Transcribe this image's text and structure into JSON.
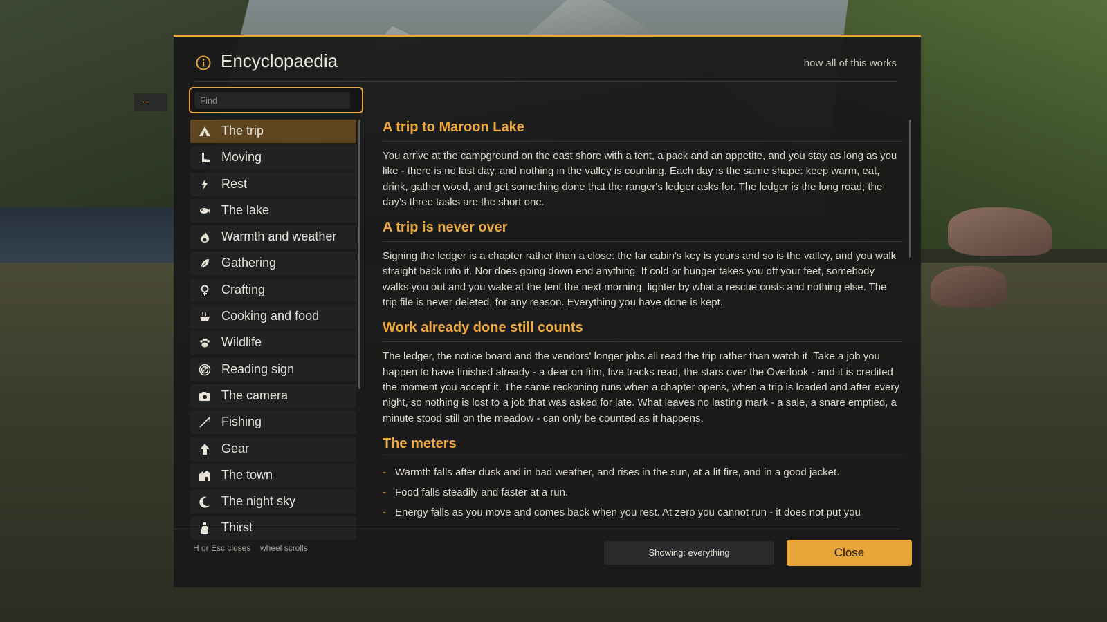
{
  "header": {
    "title": "Encyclopaedia",
    "help_link": "how all of this works"
  },
  "search": {
    "placeholder": "Find"
  },
  "side_tab": {
    "label": "–"
  },
  "topics": [
    {
      "label": "The trip",
      "icon": "tent-icon",
      "active": true
    },
    {
      "label": "Moving",
      "icon": "boot-icon"
    },
    {
      "label": "Rest",
      "icon": "lightning-icon"
    },
    {
      "label": "The lake",
      "icon": "fish-icon"
    },
    {
      "label": "Warmth and weather",
      "icon": "flame-icon"
    },
    {
      "label": "Gathering",
      "icon": "leaf-icon"
    },
    {
      "label": "Crafting",
      "icon": "knot-icon"
    },
    {
      "label": "Cooking and food",
      "icon": "pot-icon"
    },
    {
      "label": "Wildlife",
      "icon": "paw-icon"
    },
    {
      "label": "Reading sign",
      "icon": "spiral-icon"
    },
    {
      "label": "The camera",
      "icon": "camera-icon"
    },
    {
      "label": "Fishing",
      "icon": "fishing-rod-icon"
    },
    {
      "label": "Gear",
      "icon": "backpack-icon"
    },
    {
      "label": "The town",
      "icon": "house-icon"
    },
    {
      "label": "The night sky",
      "icon": "moon-icon"
    },
    {
      "label": "Thirst",
      "icon": "bottle-icon"
    }
  ],
  "article": {
    "sections": [
      {
        "heading": "A trip to Maroon Lake",
        "body": "You arrive at the campground on the east shore with a tent, a pack and an appetite, and you stay as long as you like - there is no last day, and nothing in the valley is counting. Each day is the same shape: keep warm, eat, drink, gather wood, and get something done that the ranger's ledger asks for. The ledger is the long road; the day's three tasks are the short one."
      },
      {
        "heading": "A trip is never over",
        "body": "Signing the ledger is a chapter rather than a close: the far cabin's key is yours and so is the valley, and you walk straight back into it. Nor does going down end anything. If cold or hunger takes you off your feet, somebody walks you out and you wake at the tent the next morning, lighter by what a rescue costs and nothing else. The trip file is never deleted, for any reason. Everything you have done is kept."
      },
      {
        "heading": "Work already done still counts",
        "body": "The ledger, the notice board and the vendors' longer jobs all read the trip rather than watch it. Take a job you happen to have finished already - a deer on film, five tracks read, the stars over the Overlook - and it is credited the moment you accept it. The same reckoning runs when a chapter opens, when a trip is loaded and after every night, so nothing is lost to a job that was asked for late. What leaves no lasting mark - a sale, a snare emptied, a minute stood still on the meadow - can only be counted as it happens."
      }
    ],
    "meters": {
      "heading": "The meters",
      "bullet_marker": "-",
      "bullets": [
        "Warmth falls after dusk and in bad weather, and rises in the sun, at a lit fire, and in a good jacket.",
        "Food falls steadily and faster at a run.",
        "Energy falls as you move and comes back when you rest. At zero you cannot run - it does not put you"
      ]
    }
  },
  "footer": {
    "hint_close": "H or Esc closes",
    "hint_scroll": "wheel scrolls",
    "filter_label": "Showing: everything",
    "close_label": "Close"
  },
  "colors": {
    "accent": "#e8a53a",
    "heading": "#f0a93d",
    "active_row": "#5f4621",
    "panel": "#18191a"
  }
}
